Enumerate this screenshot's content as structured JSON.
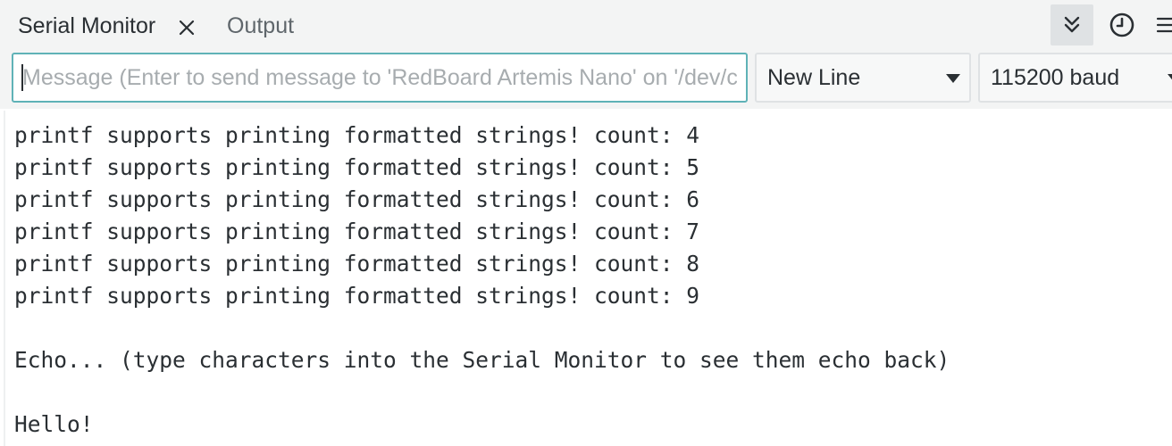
{
  "tabs": {
    "serial_monitor": "Serial Monitor",
    "output": "Output"
  },
  "icons": {
    "close": "close-icon",
    "autoscroll": "double-chevron-down-icon",
    "timestamp": "clock-icon",
    "menu": "menu-icon"
  },
  "input": {
    "value": "",
    "placeholder": "Message (Enter to send message to 'RedBoard Artemis Nano' on '/dev/cu.usbserial')"
  },
  "line_ending": {
    "selected": "New Line"
  },
  "baud_rate": {
    "selected": "115200 baud"
  },
  "output_lines": [
    "printf supports printing formatted strings! count: 4",
    "printf supports printing formatted strings! count: 5",
    "printf supports printing formatted strings! count: 6",
    "printf supports printing formatted strings! count: 7",
    "printf supports printing formatted strings! count: 8",
    "printf supports printing formatted strings! count: 9",
    "",
    "Echo... (type characters into the Serial Monitor to see them echo back)",
    "",
    "Hello!"
  ],
  "colors": {
    "focus_border": "#5fb2b7",
    "toolbar_bg": "#f3f4f4",
    "active_tool_bg": "#dfe2e4",
    "text": "#2a2f33"
  }
}
